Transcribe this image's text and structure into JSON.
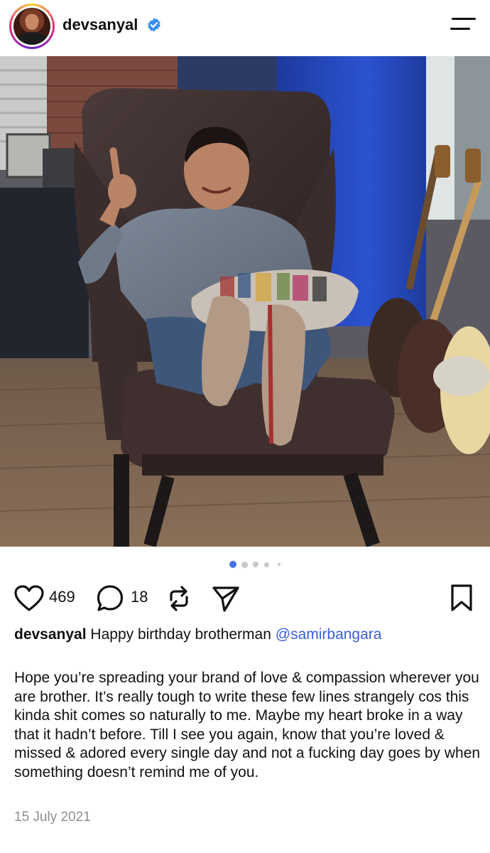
{
  "header": {
    "username": "devsanyal",
    "verified": true,
    "avatar_icon": "profile-avatar",
    "menu_icon": "menu-icon"
  },
  "post": {
    "image": {
      "description_icon": "post-photo"
    },
    "carousel": {
      "total": 5,
      "active_index": 0
    },
    "actions": {
      "likes": "469",
      "comments": "18"
    },
    "caption": {
      "username": "devsanyal",
      "text": "Happy birthday brotherman",
      "mention": "@samirbangara"
    },
    "body": "Hope you’re spreading your brand of love & compassion wherever you are brother. It’s really tough to write these few lines strangely cos this kinda shit comes so naturally to me. Maybe my heart broke in a way that it hadn’t before. Till I see you again, know that you’re loved & missed & adored every single day and not a fucking day goes by when something doesn’t remind me of you.",
    "date": "15 July 2021"
  },
  "colors": {
    "accent": "#3b5fd9",
    "verified": "#3a8ef0",
    "muted": "#8e8e93",
    "dot_active": "#4a72e8",
    "dot_inactive": "#c7c7cc"
  }
}
